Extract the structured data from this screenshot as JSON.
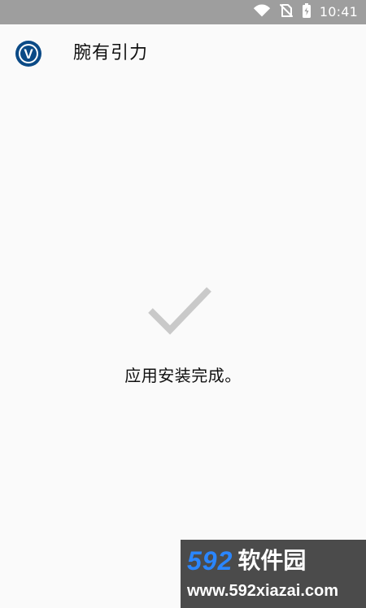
{
  "status_bar": {
    "time": "10:41",
    "icons": [
      "wifi-icon",
      "no-sim-icon",
      "battery-charging-icon"
    ]
  },
  "app": {
    "name": "腕有引力",
    "logo_text": "V"
  },
  "install": {
    "message": "应用安装完成。"
  },
  "watermark": {
    "numbers": "592",
    "brand": "软件园",
    "url": "www.592xiazai.com"
  },
  "colors": {
    "status_bar_bg": "#9e9e9e",
    "page_bg": "#fafafa",
    "check_mark": "#c9c9c9",
    "logo_blue": "#0b4a86",
    "watermark_blue": "#2a86ff"
  }
}
